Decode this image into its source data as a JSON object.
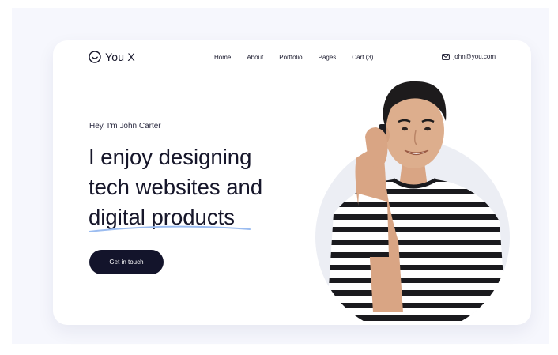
{
  "brand": {
    "name": "You X",
    "icon": "smile-circle-icon"
  },
  "nav": {
    "items": [
      "Home",
      "About",
      "Portfolio",
      "Pages",
      "Cart (3)"
    ]
  },
  "contact": {
    "email": "john@you.com",
    "icon": "mail-icon"
  },
  "hero": {
    "eyebrow": "Hey, I'm John Carter",
    "headline_lines": [
      "I enjoy designing",
      "tech websites and",
      "digital products"
    ],
    "cta_label": "Get in touch"
  },
  "colors": {
    "dark": "#13142b",
    "page_bg": "#f6f7fd",
    "circle": "#eceef4",
    "accent_underline": "#9bbcf0"
  }
}
